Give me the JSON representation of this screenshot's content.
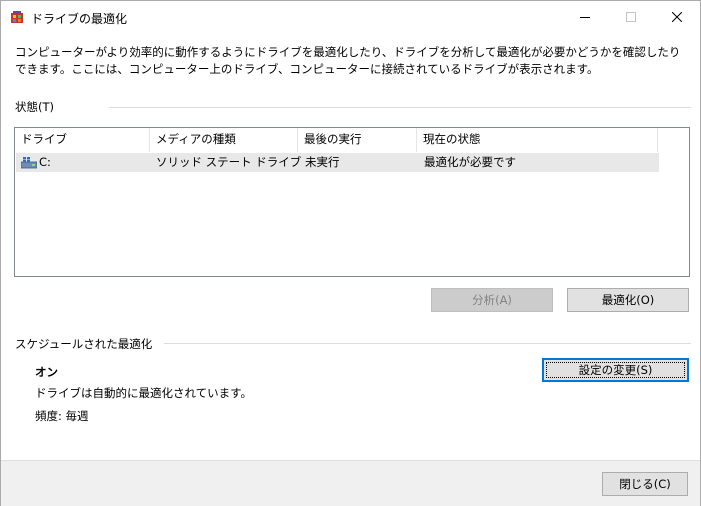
{
  "window": {
    "title": "ドライブの最適化",
    "icon": "defrag-app-icon"
  },
  "description": "コンピューターがより効率的に動作するようにドライブを最適化したり、ドライブを分析して最適化が必要かどうかを確認したりできます。ここには、コンピューター上のドライブ、コンピューターに接続されているドライブが表示されます。",
  "status_group": {
    "label": "状態(T)"
  },
  "drive_list": {
    "columns": [
      "ドライブ",
      "メディアの種類",
      "最後の実行",
      "現在の状態"
    ],
    "rows": [
      {
        "drive": "C:",
        "media_type": "ソリッド ステート ドライブ",
        "last_run": "未実行",
        "status": "最適化が必要です"
      }
    ]
  },
  "buttons": {
    "analyze": "分析(A)",
    "optimize": "最適化(O)",
    "change_settings": "設定の変更(S)",
    "close": "閉じる(C)"
  },
  "schedule": {
    "label": "スケジュールされた最適化",
    "state": "オン",
    "message": "ドライブは自動的に最適化されています。",
    "frequency": "頻度: 毎週"
  },
  "colors": {
    "accent": "#0078d7",
    "footer_bg": "#f0f0f0",
    "selected_row": "#e8e8e8"
  }
}
